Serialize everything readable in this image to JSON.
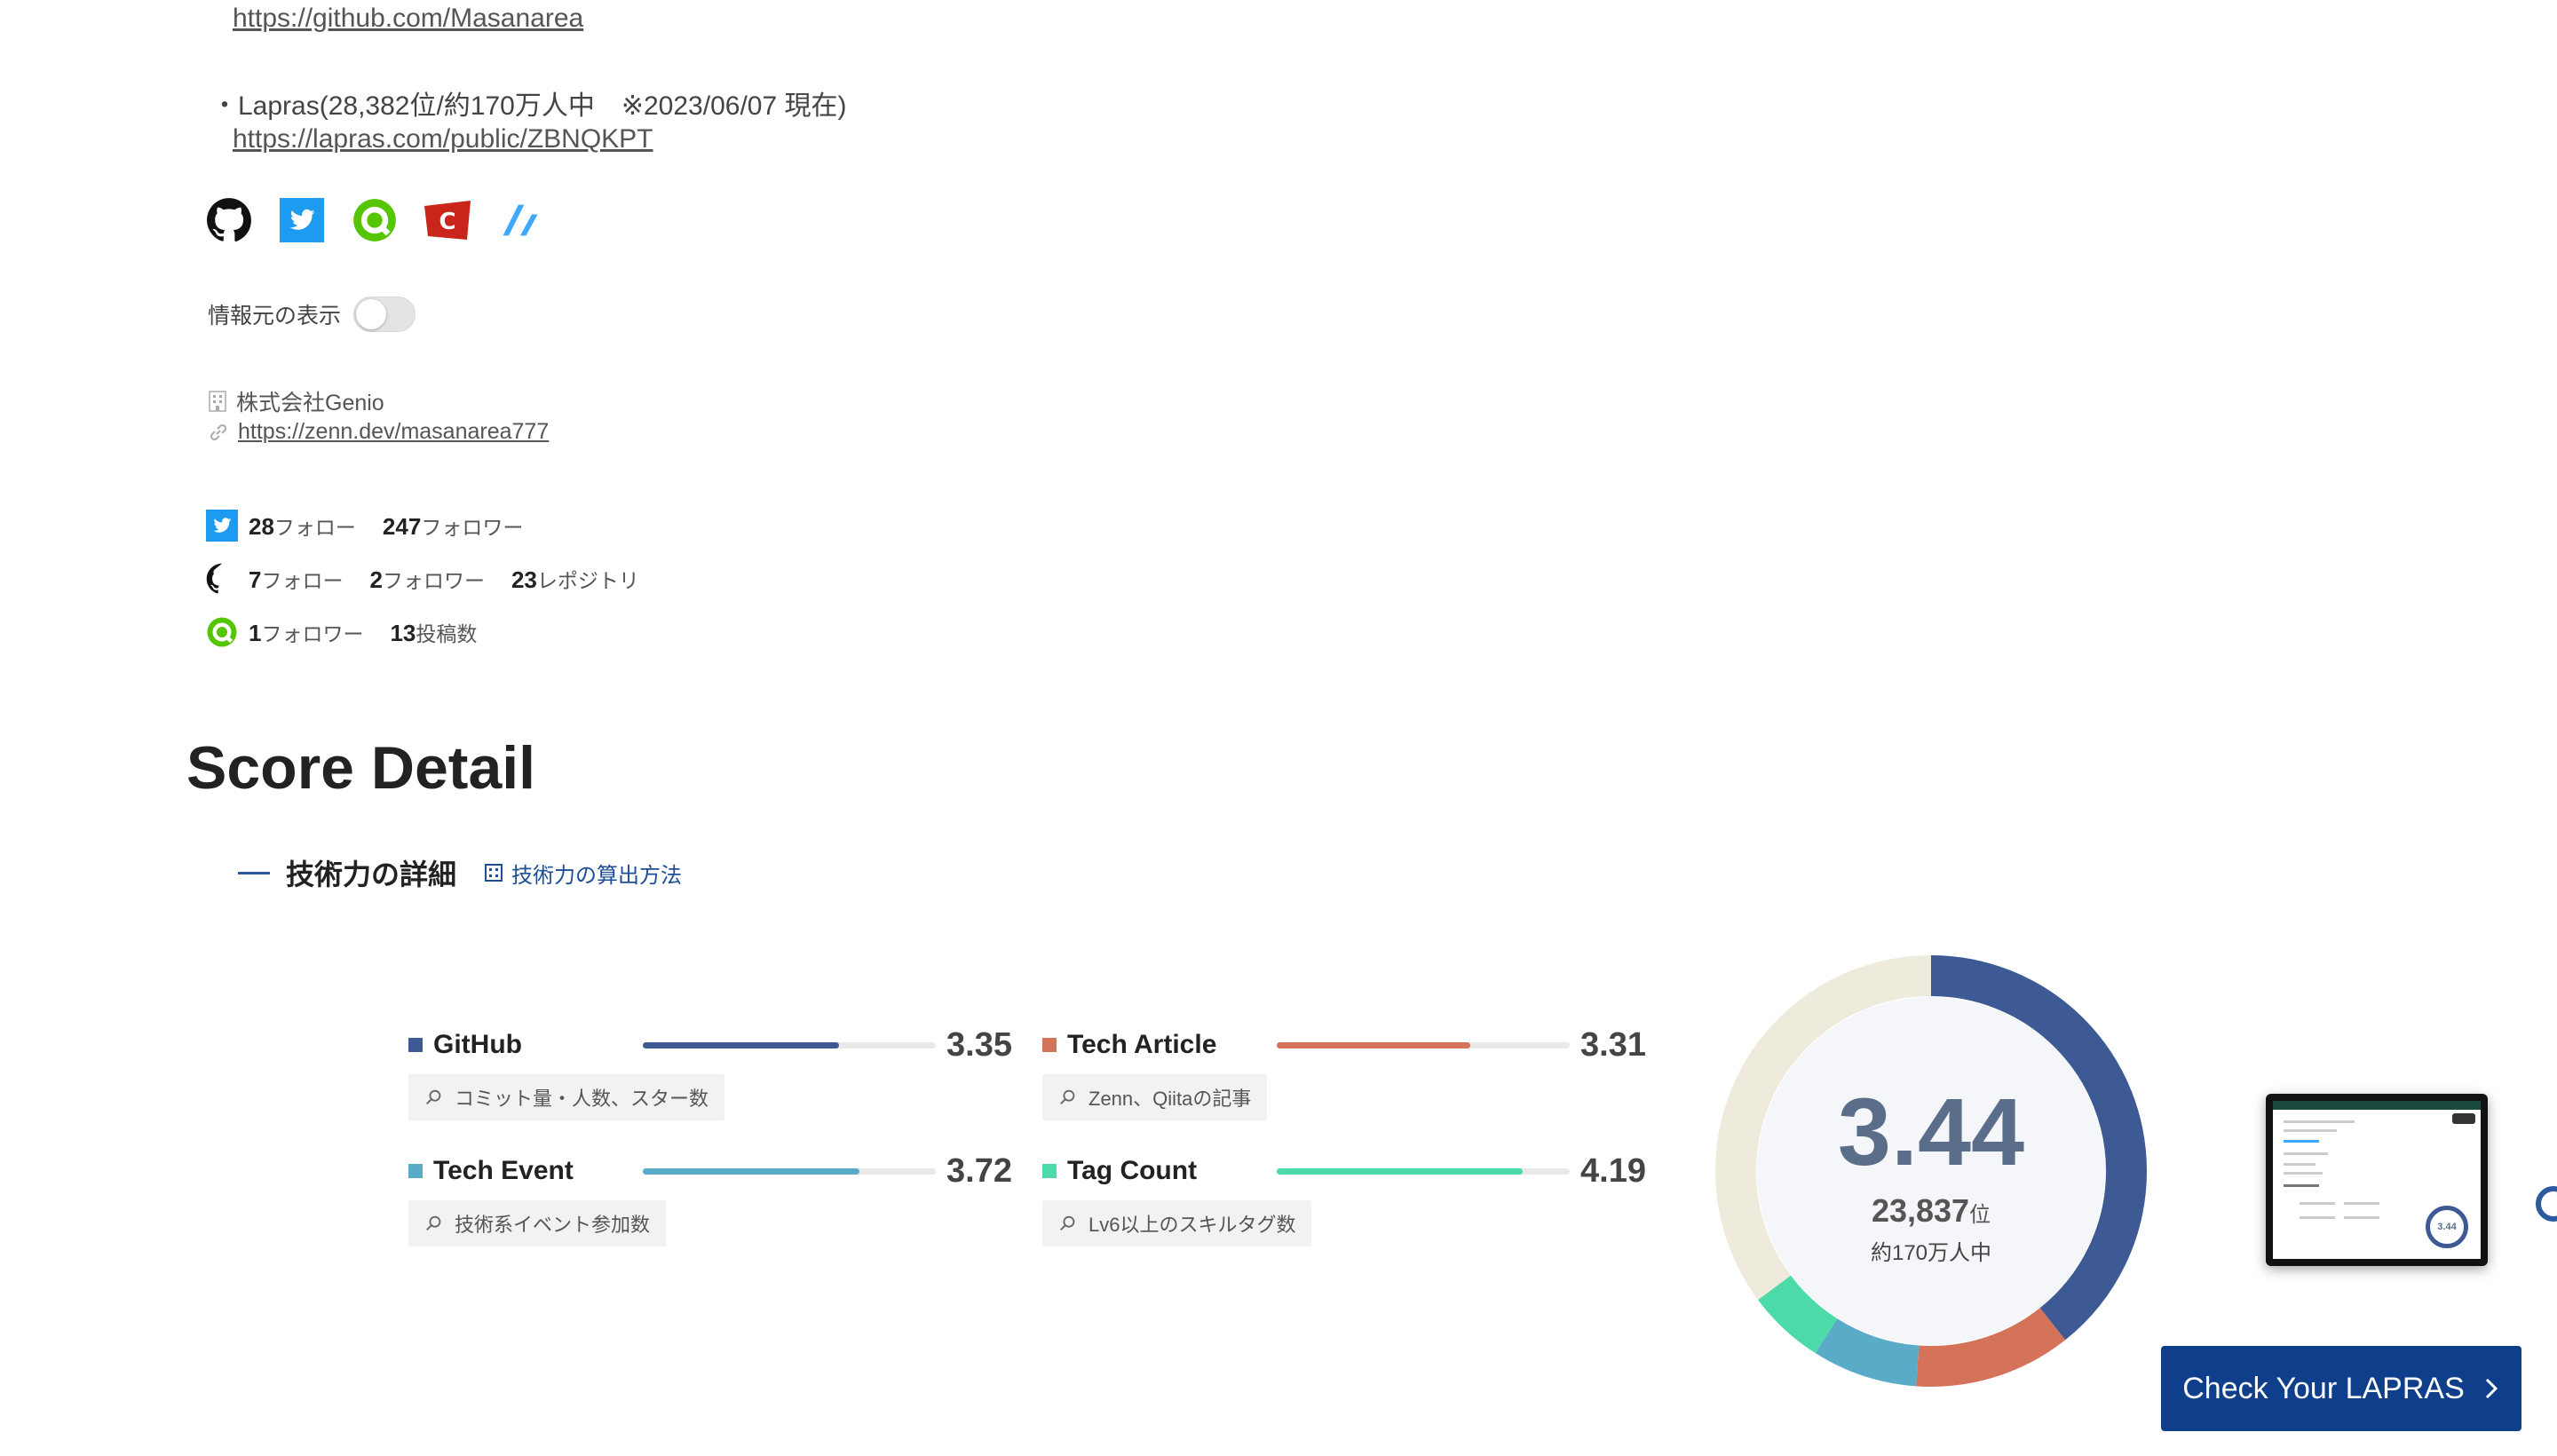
{
  "profile": {
    "github_url": "https://github.com/Masanarea",
    "lapras_line": "・Lapras(28,382位/約170万人中　※2023/06/07 現在)",
    "lapras_url": "https://lapras.com/public/ZBNQKPT",
    "service_icons": [
      "github-icon",
      "twitter-icon",
      "qiita-icon",
      "connpass-icon",
      "zenn-icon"
    ],
    "toggle_label": "情報元の表示",
    "company": "株式会社Genio",
    "website": "https://zenn.dev/masanarea777"
  },
  "stats": {
    "twitter": {
      "follow": "28",
      "follow_label": "フォロー",
      "followers": "247",
      "followers_label": "フォロワー"
    },
    "github": {
      "follow": "7",
      "follow_label": "フォロー",
      "followers": "2",
      "followers_label": "フォロワー",
      "repos": "23",
      "repos_label": "レポジトリ"
    },
    "qiita": {
      "followers": "1",
      "followers_label": "フォロワー",
      "posts": "13",
      "posts_label": "投稿数"
    }
  },
  "score_detail": {
    "title": "Score Detail",
    "section_title": "技術力の詳細",
    "calc_link": "技術力の算出方法",
    "items": [
      {
        "name": "GitHub",
        "value": "3.35",
        "fraction": 0.67,
        "color": "#3d5a94",
        "desc": "コミット量・人数、スター数"
      },
      {
        "name": "Tech Article",
        "value": "3.31",
        "fraction": 0.66,
        "color": "#d4735a",
        "desc": "Zenn、Qiitaの記事"
      },
      {
        "name": "Tech Event",
        "value": "3.72",
        "fraction": 0.74,
        "color": "#5aabc8",
        "desc": "技術系イベント参加数"
      },
      {
        "name": "Tag Count",
        "value": "4.19",
        "fraction": 0.84,
        "color": "#4cdba8",
        "desc": "Lv6以上のスキルタグ数"
      }
    ],
    "total": "3.44",
    "rank": "23,837",
    "rank_suffix": "位",
    "population": "約170万人中",
    "donut_segments": [
      {
        "fraction": 0.393,
        "color": "#3d5a94"
      },
      {
        "fraction": 0.118,
        "color": "#d4735a"
      },
      {
        "fraction": 0.079,
        "color": "#5aabc8"
      },
      {
        "fraction": 0.058,
        "color": "#4cdba8"
      },
      {
        "fraction": 0.352,
        "color": "#eeebdd"
      }
    ],
    "cta_label": "Check Your LAPRAS"
  }
}
